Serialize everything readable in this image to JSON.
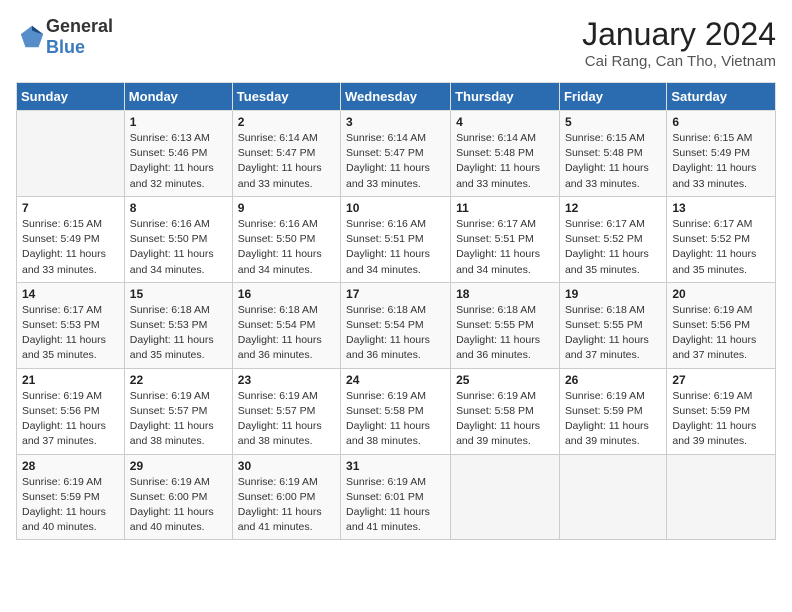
{
  "logo": {
    "general": "General",
    "blue": "Blue"
  },
  "header": {
    "month": "January 2024",
    "location": "Cai Rang, Can Tho, Vietnam"
  },
  "weekdays": [
    "Sunday",
    "Monday",
    "Tuesday",
    "Wednesday",
    "Thursday",
    "Friday",
    "Saturday"
  ],
  "weeks": [
    [
      {
        "day": "",
        "sunrise": "",
        "sunset": "",
        "daylight": ""
      },
      {
        "day": "1",
        "sunrise": "Sunrise: 6:13 AM",
        "sunset": "Sunset: 5:46 PM",
        "daylight": "Daylight: 11 hours and 32 minutes."
      },
      {
        "day": "2",
        "sunrise": "Sunrise: 6:14 AM",
        "sunset": "Sunset: 5:47 PM",
        "daylight": "Daylight: 11 hours and 33 minutes."
      },
      {
        "day": "3",
        "sunrise": "Sunrise: 6:14 AM",
        "sunset": "Sunset: 5:47 PM",
        "daylight": "Daylight: 11 hours and 33 minutes."
      },
      {
        "day": "4",
        "sunrise": "Sunrise: 6:14 AM",
        "sunset": "Sunset: 5:48 PM",
        "daylight": "Daylight: 11 hours and 33 minutes."
      },
      {
        "day": "5",
        "sunrise": "Sunrise: 6:15 AM",
        "sunset": "Sunset: 5:48 PM",
        "daylight": "Daylight: 11 hours and 33 minutes."
      },
      {
        "day": "6",
        "sunrise": "Sunrise: 6:15 AM",
        "sunset": "Sunset: 5:49 PM",
        "daylight": "Daylight: 11 hours and 33 minutes."
      }
    ],
    [
      {
        "day": "7",
        "sunrise": "Sunrise: 6:15 AM",
        "sunset": "Sunset: 5:49 PM",
        "daylight": "Daylight: 11 hours and 33 minutes."
      },
      {
        "day": "8",
        "sunrise": "Sunrise: 6:16 AM",
        "sunset": "Sunset: 5:50 PM",
        "daylight": "Daylight: 11 hours and 34 minutes."
      },
      {
        "day": "9",
        "sunrise": "Sunrise: 6:16 AM",
        "sunset": "Sunset: 5:50 PM",
        "daylight": "Daylight: 11 hours and 34 minutes."
      },
      {
        "day": "10",
        "sunrise": "Sunrise: 6:16 AM",
        "sunset": "Sunset: 5:51 PM",
        "daylight": "Daylight: 11 hours and 34 minutes."
      },
      {
        "day": "11",
        "sunrise": "Sunrise: 6:17 AM",
        "sunset": "Sunset: 5:51 PM",
        "daylight": "Daylight: 11 hours and 34 minutes."
      },
      {
        "day": "12",
        "sunrise": "Sunrise: 6:17 AM",
        "sunset": "Sunset: 5:52 PM",
        "daylight": "Daylight: 11 hours and 35 minutes."
      },
      {
        "day": "13",
        "sunrise": "Sunrise: 6:17 AM",
        "sunset": "Sunset: 5:52 PM",
        "daylight": "Daylight: 11 hours and 35 minutes."
      }
    ],
    [
      {
        "day": "14",
        "sunrise": "Sunrise: 6:17 AM",
        "sunset": "Sunset: 5:53 PM",
        "daylight": "Daylight: 11 hours and 35 minutes."
      },
      {
        "day": "15",
        "sunrise": "Sunrise: 6:18 AM",
        "sunset": "Sunset: 5:53 PM",
        "daylight": "Daylight: 11 hours and 35 minutes."
      },
      {
        "day": "16",
        "sunrise": "Sunrise: 6:18 AM",
        "sunset": "Sunset: 5:54 PM",
        "daylight": "Daylight: 11 hours and 36 minutes."
      },
      {
        "day": "17",
        "sunrise": "Sunrise: 6:18 AM",
        "sunset": "Sunset: 5:54 PM",
        "daylight": "Daylight: 11 hours and 36 minutes."
      },
      {
        "day": "18",
        "sunrise": "Sunrise: 6:18 AM",
        "sunset": "Sunset: 5:55 PM",
        "daylight": "Daylight: 11 hours and 36 minutes."
      },
      {
        "day": "19",
        "sunrise": "Sunrise: 6:18 AM",
        "sunset": "Sunset: 5:55 PM",
        "daylight": "Daylight: 11 hours and 37 minutes."
      },
      {
        "day": "20",
        "sunrise": "Sunrise: 6:19 AM",
        "sunset": "Sunset: 5:56 PM",
        "daylight": "Daylight: 11 hours and 37 minutes."
      }
    ],
    [
      {
        "day": "21",
        "sunrise": "Sunrise: 6:19 AM",
        "sunset": "Sunset: 5:56 PM",
        "daylight": "Daylight: 11 hours and 37 minutes."
      },
      {
        "day": "22",
        "sunrise": "Sunrise: 6:19 AM",
        "sunset": "Sunset: 5:57 PM",
        "daylight": "Daylight: 11 hours and 38 minutes."
      },
      {
        "day": "23",
        "sunrise": "Sunrise: 6:19 AM",
        "sunset": "Sunset: 5:57 PM",
        "daylight": "Daylight: 11 hours and 38 minutes."
      },
      {
        "day": "24",
        "sunrise": "Sunrise: 6:19 AM",
        "sunset": "Sunset: 5:58 PM",
        "daylight": "Daylight: 11 hours and 38 minutes."
      },
      {
        "day": "25",
        "sunrise": "Sunrise: 6:19 AM",
        "sunset": "Sunset: 5:58 PM",
        "daylight": "Daylight: 11 hours and 39 minutes."
      },
      {
        "day": "26",
        "sunrise": "Sunrise: 6:19 AM",
        "sunset": "Sunset: 5:59 PM",
        "daylight": "Daylight: 11 hours and 39 minutes."
      },
      {
        "day": "27",
        "sunrise": "Sunrise: 6:19 AM",
        "sunset": "Sunset: 5:59 PM",
        "daylight": "Daylight: 11 hours and 39 minutes."
      }
    ],
    [
      {
        "day": "28",
        "sunrise": "Sunrise: 6:19 AM",
        "sunset": "Sunset: 5:59 PM",
        "daylight": "Daylight: 11 hours and 40 minutes."
      },
      {
        "day": "29",
        "sunrise": "Sunrise: 6:19 AM",
        "sunset": "Sunset: 6:00 PM",
        "daylight": "Daylight: 11 hours and 40 minutes."
      },
      {
        "day": "30",
        "sunrise": "Sunrise: 6:19 AM",
        "sunset": "Sunset: 6:00 PM",
        "daylight": "Daylight: 11 hours and 41 minutes."
      },
      {
        "day": "31",
        "sunrise": "Sunrise: 6:19 AM",
        "sunset": "Sunset: 6:01 PM",
        "daylight": "Daylight: 11 hours and 41 minutes."
      },
      {
        "day": "",
        "sunrise": "",
        "sunset": "",
        "daylight": ""
      },
      {
        "day": "",
        "sunrise": "",
        "sunset": "",
        "daylight": ""
      },
      {
        "day": "",
        "sunrise": "",
        "sunset": "",
        "daylight": ""
      }
    ]
  ]
}
